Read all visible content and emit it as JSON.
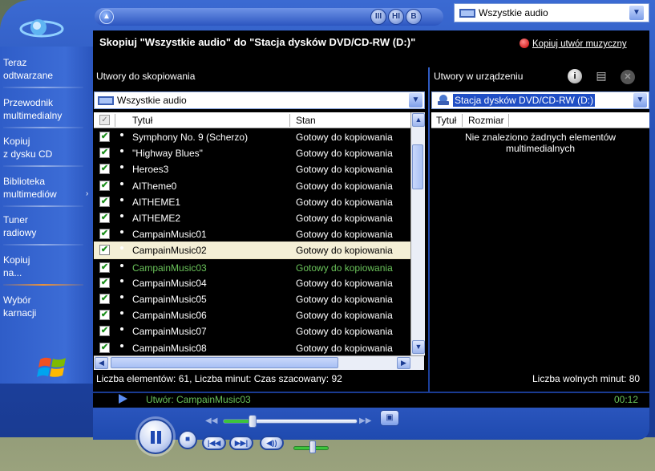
{
  "colors": {
    "frame_blue": "#2852b8",
    "pane_bg": "#000000",
    "playing_green": "#6ac35a",
    "highlight_row": "#f4efd6",
    "check_green": "#1b8e1b"
  },
  "top": {
    "source_dropdown_value": "Wszystkie audio",
    "buttons": [
      "III",
      "HI",
      "B"
    ]
  },
  "titlebar": {
    "title": "Skopiuj \"Wszystkie audio\" do \"Stacja dysków DVD/CD-RW (D:)\"",
    "copy_music_label": "Kopiuj utwór muzyczny"
  },
  "sidebar": {
    "items": [
      {
        "label1": "Teraz",
        "label2": "odtwarzane"
      },
      {
        "label1": "Przewodnik",
        "label2": "multimedialny"
      },
      {
        "label1": "Kopiuj",
        "label2": "z dysku CD"
      },
      {
        "label1": "Biblioteka",
        "label2": "multimediów"
      },
      {
        "label1": "Tuner",
        "label2": "radiowy"
      },
      {
        "label1": "Kopiuj",
        "label2": "na..."
      },
      {
        "label1": "Wybór",
        "label2": "karnacji"
      }
    ]
  },
  "left_pane": {
    "header": "Utwory do skopiowania",
    "select_value": "Wszystkie audio",
    "columns": {
      "title": "Tytuł",
      "state": "Stan"
    },
    "rows": [
      {
        "title": "Symphony No. 9 (Scherzo)",
        "state": "Gotowy do kopiowania"
      },
      {
        "title": "\"Highway Blues\"",
        "state": "Gotowy do kopiowania"
      },
      {
        "title": "Heroes3",
        "state": "Gotowy do kopiowania"
      },
      {
        "title": "AITheme0",
        "state": "Gotowy do kopiowania"
      },
      {
        "title": "AITHEME1",
        "state": "Gotowy do kopiowania"
      },
      {
        "title": "AITHEME2",
        "state": "Gotowy do kopiowania"
      },
      {
        "title": "CampainMusic01",
        "state": "Gotowy do kopiowania"
      },
      {
        "title": "CampainMusic02",
        "state": "Gotowy do kopiowania"
      },
      {
        "title": "CampainMusic03",
        "state": "Gotowy do kopiowania"
      },
      {
        "title": "CampainMusic04",
        "state": "Gotowy do kopiowania"
      },
      {
        "title": "CampainMusic05",
        "state": "Gotowy do kopiowania"
      },
      {
        "title": "CampainMusic06",
        "state": "Gotowy do kopiowania"
      },
      {
        "title": "CampainMusic07",
        "state": "Gotowy do kopiowania"
      },
      {
        "title": "CampainMusic08",
        "state": "Gotowy do kopiowania"
      }
    ],
    "highlighted_row": 7,
    "playing_row": 8,
    "status": "Liczba elementów: 61, Liczba minut: Czas szacowany: 92"
  },
  "right_pane": {
    "header": "Utwory w urządzeniu",
    "select_value": "Stacja dysków DVD/CD-RW (D:)",
    "columns": {
      "title": "Tytuł",
      "size": "Rozmiar"
    },
    "empty_message_line1": "Nie znaleziono żadnych elementów",
    "empty_message_line2": "multimedialnych",
    "status": "Liczba wolnych minut: 80"
  },
  "now_playing": {
    "track": "Utwór: CampainMusic03",
    "time": "00:12"
  },
  "transport": {
    "seek_fraction": 0.22,
    "volume_fraction": 0.55
  }
}
